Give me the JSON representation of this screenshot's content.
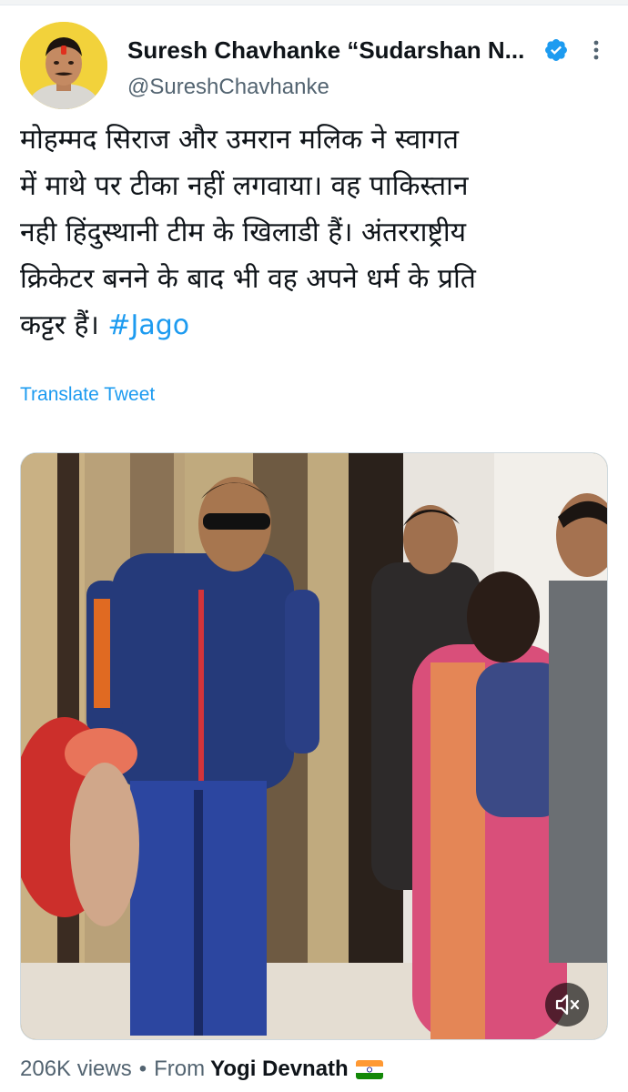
{
  "tweet": {
    "author": {
      "display_name": "Suresh Chavhanke “Sudarshan N...",
      "handle": "@SureshChavhanke",
      "verified": true,
      "avatar_icon": "profile-photo"
    },
    "text_lines": [
      "मोहम्मद सिराज और उमरान मलिक ने स्वागत",
      "में माथे पर टीका नहीं लगवाया। वह पाकिस्तान",
      "नही हिंदुस्थानी टीम के खिलाडी हैं। अंतरराष्ट्रीय",
      "क्रिकेटर बनने के बाद भी वह अपने धर्म के प्रति",
      "कट्टर हैं।"
    ],
    "hashtag": "#Jago",
    "translate_label": "Translate Tweet",
    "media": {
      "type": "video",
      "mute_icon": "volume-muted-icon"
    },
    "views": "206K views",
    "separator": "•",
    "from_label": "From",
    "source_name": "Yogi Devnath",
    "source_flag_icon": "india-flag-icon"
  },
  "colors": {
    "accent": "#1d9bf0",
    "secondary_text": "#536471",
    "primary_text": "#0f1419",
    "verified_badge": "#1d9bf0"
  }
}
